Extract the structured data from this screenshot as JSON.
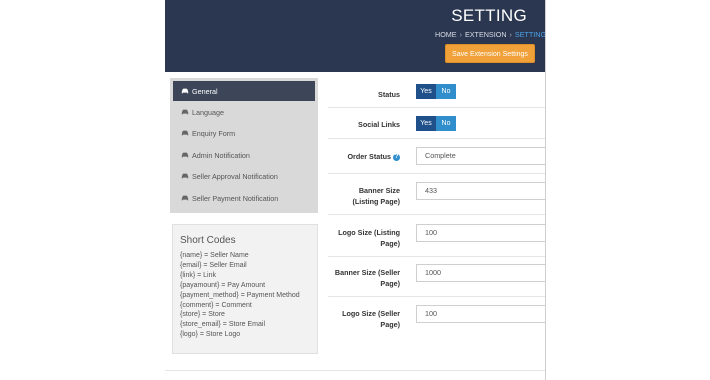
{
  "header": {
    "title": "SETTING",
    "breadcrumb": [
      "HOME",
      "EXTENSION",
      "SETTING"
    ],
    "breadcrumb_sep": "›",
    "save_label": "Save Extension Settings"
  },
  "sidebar": {
    "items": [
      {
        "label": "General",
        "active": true
      },
      {
        "label": "Language",
        "active": false
      },
      {
        "label": "Enquiry Form",
        "active": false
      },
      {
        "label": "Admin Notification",
        "active": false
      },
      {
        "label": "Seller Approval Notification",
        "active": false
      },
      {
        "label": "Seller Payment Notification",
        "active": false
      }
    ]
  },
  "short_codes": {
    "title": "Short Codes",
    "lines": [
      "{name} = Seller Name",
      "{email} = Seller Email",
      "{link} = Link",
      "{payamount} = Pay Amount",
      "{payment_method} = Payment Method",
      "{comment} = Comment",
      "{store} = Store",
      "{store_email} = Store Email",
      "{logo} = Store Logo"
    ]
  },
  "form": {
    "status": {
      "label": "Status",
      "yes": "Yes",
      "no": "No",
      "selected": "Yes"
    },
    "social_links": {
      "label": "Social Links",
      "yes": "Yes",
      "no": "No",
      "selected": "Yes"
    },
    "order_status": {
      "label": "Order Status",
      "help": "?",
      "value": "Complete"
    },
    "banner_size_listing": {
      "label_line1": "Banner Size",
      "label_line2": "(Listing Page)",
      "value": "433"
    },
    "logo_size_listing": {
      "label_line1": "Logo Size (Listing",
      "label_line2": "Page)",
      "value": "100"
    },
    "banner_size_seller": {
      "label_line1": "Banner Size (Seller",
      "label_line2": "Page)",
      "value": "1000"
    },
    "logo_size_seller": {
      "label_line1": "Logo Size (Seller",
      "label_line2": "Page)",
      "value": "100"
    }
  },
  "colors": {
    "header_bg": "#2b3750",
    "save_button": "#f0a13a",
    "toggle_yes": "#20508a",
    "toggle_no": "#2f8ecb",
    "breadcrumb_active": "#4da3e8"
  }
}
